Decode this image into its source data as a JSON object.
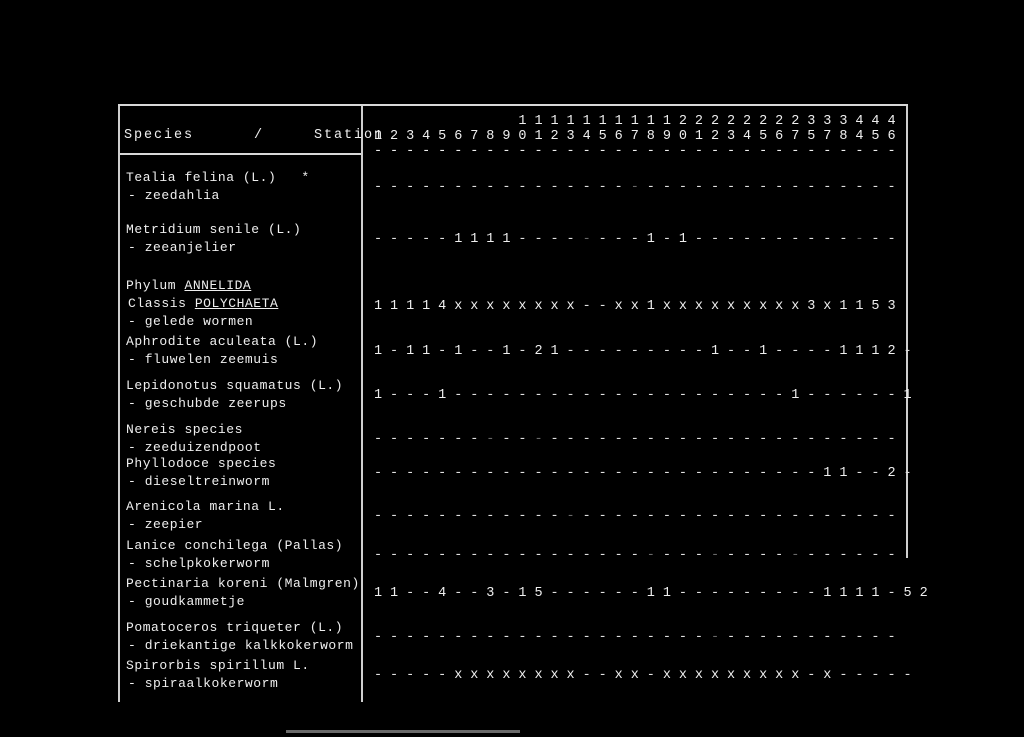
{
  "document": {
    "kind": "scanned-table-page",
    "header": {
      "species_label": "Species      /     Station"
    },
    "stations": {
      "tens": [
        " ",
        " ",
        " ",
        " ",
        " ",
        " ",
        " ",
        " ",
        " ",
        "1",
        "1",
        "1",
        "1",
        "1",
        "1",
        "1",
        "1",
        "1",
        "1",
        "2",
        "2",
        "2",
        "2",
        "2",
        "2",
        "2",
        "2",
        "3",
        "3",
        "3",
        "4",
        "4",
        "4"
      ],
      "units": [
        "1",
        "2",
        "3",
        "4",
        "5",
        "6",
        "7",
        "8",
        "9",
        "0",
        "1",
        "2",
        "3",
        "4",
        "5",
        "6",
        "7",
        "8",
        "9",
        "0",
        "1",
        "2",
        "3",
        "4",
        "5",
        "6",
        "7",
        "5",
        "7",
        "8",
        "4",
        "5",
        "6"
      ],
      "labels": [
        "1",
        "2",
        "3",
        "4",
        "5",
        "6",
        "7",
        "8",
        "9",
        "10",
        "11",
        "12",
        "13",
        "14",
        "15",
        "16",
        "17",
        "18",
        "19",
        "20",
        "21",
        "22",
        "23",
        "24",
        "25",
        "26",
        "27",
        "35",
        "37",
        "38",
        "44",
        "45",
        "46"
      ],
      "rule_row": [
        "-",
        "-",
        "-",
        "-",
        "-",
        "-",
        "-",
        "-",
        "-",
        "-",
        "-",
        "-",
        "-",
        "-",
        "-",
        "-",
        "-",
        "-",
        "-",
        "-",
        "-",
        "-",
        "-",
        "-",
        "-",
        "-",
        "-",
        "-",
        "-",
        "-",
        "-",
        "-",
        "-"
      ]
    },
    "rows": [
      {
        "id": "tealia-felina",
        "name_lines": [
          "Tealia felina (L.)   *",
          "- zeedahlia"
        ],
        "underline_words": [],
        "values": [
          "-",
          "-",
          "-",
          "-",
          "-",
          "-",
          "-",
          "-",
          "-",
          "-",
          "-",
          "-",
          "-",
          "-",
          "-",
          "-",
          ".",
          "-",
          "-",
          "-",
          "-",
          "-",
          "-",
          "-",
          "-",
          "-",
          "-",
          "-",
          "-",
          "-",
          "-",
          "-",
          "-"
        ]
      },
      {
        "id": "metridium-senile",
        "name_lines": [
          "Metridium senile (L.)",
          "- zeeanjelier"
        ],
        "underline_words": [],
        "values": [
          "-",
          "-",
          "-",
          "-",
          "-",
          "1",
          "1",
          "1",
          "1",
          "-",
          "-",
          "-",
          "-",
          ".",
          "-",
          "-",
          "-",
          "1",
          "-",
          "1",
          "-",
          "-",
          "-",
          "-",
          "-",
          "-",
          "-",
          "-",
          "-",
          "-",
          ".",
          "-",
          "-"
        ]
      },
      {
        "id": "phylum-annelida-polychaeta",
        "name_lines": [
          "Phylum ANNELIDA",
          "Classis POLYCHAETA",
          "- gelede wormen"
        ],
        "underline_words": [
          "ANNELIDA",
          "POLYCHAETA"
        ],
        "values": [
          "1",
          "1",
          "1",
          "1",
          "4",
          "x",
          "x",
          "x",
          "x",
          "x",
          "x",
          "x",
          "x",
          "-",
          "-",
          "x",
          "x",
          "1",
          "x",
          "x",
          "x",
          "x",
          "x",
          "x",
          "x",
          "x",
          "x",
          "3",
          "x",
          "1",
          "1",
          "5",
          "3"
        ]
      },
      {
        "id": "aphrodite-aculeata",
        "name_lines": [
          "Aphrodite aculeata (L.)",
          "- fluwelen zeemuis"
        ],
        "underline_words": [],
        "values": [
          "1",
          "-",
          "1",
          "1",
          "-",
          "1",
          "-",
          "-",
          "1",
          "-",
          "2",
          "1",
          "-",
          "-",
          "-",
          "-",
          "-",
          "-",
          "-",
          "-",
          "-",
          "1",
          "-",
          "-",
          "1",
          "-",
          "-",
          "-",
          "-",
          "1",
          "1",
          "1",
          "2",
          "-"
        ]
      },
      {
        "id": "lepidonotus-squamatus",
        "name_lines": [
          "Lepidonotus squamatus (L.)",
          "- geschubde zeerups"
        ],
        "underline_words": [],
        "values": [
          "1",
          "-",
          "-",
          "-",
          "1",
          "-",
          "-",
          "-",
          "-",
          "-",
          "-",
          "-",
          "-",
          "-",
          "-",
          "-",
          "-",
          "-",
          "-",
          "-",
          "-",
          "-",
          "-",
          "-",
          "-",
          "-",
          "1",
          "-",
          "-",
          "-",
          "-",
          "-",
          "-",
          "1"
        ]
      },
      {
        "id": "nereis-species",
        "name_lines": [
          "Nereis species",
          "- zeeduizendpoot"
        ],
        "underline_words": [],
        "values": [
          "-",
          "-",
          "-",
          "-",
          "-",
          "-",
          "-",
          ".",
          "-",
          "-",
          ".",
          "-",
          "-",
          "-",
          "-",
          "-",
          "-",
          "-",
          "-",
          "-",
          "-",
          "-",
          "-",
          "-",
          "-",
          "-",
          "-",
          "-",
          "-",
          "-",
          "-",
          "-",
          "-"
        ]
      },
      {
        "id": "phyllodoce-species",
        "name_lines": [
          "Phyllodoce species",
          "- dieseltreinworm"
        ],
        "underline_words": [],
        "values": [
          "-",
          "-",
          "-",
          "-",
          "-",
          "-",
          "-",
          "-",
          "-",
          "-",
          "-",
          "-",
          "-",
          "-",
          "-",
          "-",
          "-",
          "-",
          "-",
          "-",
          "-",
          "-",
          "-",
          "-",
          "-",
          "-",
          "-",
          "-",
          "1",
          "1",
          "-",
          "-",
          "2",
          "-"
        ]
      },
      {
        "id": "arenicola-marina",
        "name_lines": [
          "Arenicola marina L.",
          "- zeepier"
        ],
        "underline_words": [],
        "values": [
          "-",
          "-",
          "-",
          "-",
          "-",
          "-",
          "-",
          "-",
          "-",
          "-",
          "-",
          "-",
          ".",
          "-",
          "-",
          "-",
          "-",
          "-",
          "-",
          "-",
          "-",
          "-",
          "-",
          "-",
          "-",
          "-",
          "-",
          "-",
          "-",
          "-",
          "-",
          "-",
          "-"
        ]
      },
      {
        "id": "lanice-conchilega",
        "name_lines": [
          "Lanice conchilega (Pallas)",
          "- schelpkokerworm"
        ],
        "underline_words": [],
        "values": [
          "-",
          "-",
          "-",
          "-",
          "-",
          "-",
          "-",
          "-",
          "-",
          "-",
          "-",
          "-",
          "-",
          "-",
          "-",
          "-",
          "-",
          ",",
          "-",
          "-",
          "-",
          ".",
          "-",
          "-",
          "-",
          "-",
          ",",
          "-",
          "-",
          "-",
          "-",
          "-",
          "-"
        ]
      },
      {
        "id": "pectinaria-koreni",
        "name_lines": [
          "Pectinaria koreni (Malmgren)",
          "- goudkammetje"
        ],
        "underline_words": [],
        "values": [
          "1",
          "1",
          "-",
          "-",
          "4",
          "-",
          "-",
          "3",
          "-",
          "1",
          "5",
          "-",
          "-",
          "-",
          "-",
          "-",
          "-",
          "1",
          "1",
          "-",
          "-",
          "-",
          "-",
          "-",
          "-",
          "-",
          "-",
          "-",
          "1",
          "1",
          "1",
          "1",
          "-",
          "5",
          "2"
        ]
      },
      {
        "id": "pomatoceros-triqueter",
        "name_lines": [
          "Pomatoceros triqueter (L.)",
          "- driekantige kalkkokerworm"
        ],
        "underline_words": [],
        "values": [
          "-",
          "-",
          "-",
          "-",
          "-",
          "-",
          "-",
          "-",
          "-",
          "-",
          "-",
          "-",
          "-",
          "-",
          "-",
          "-",
          "-",
          "-",
          "-",
          "-",
          "-",
          ".",
          "-",
          "-",
          "-",
          "-",
          "-",
          "-",
          "-",
          "-",
          "-",
          "-",
          "-"
        ]
      },
      {
        "id": "spirorbis-spirillum",
        "name_lines": [
          "Spirorbis spirillum L.",
          "- spiraalkokerworm"
        ],
        "underline_words": [],
        "values": [
          "-",
          "-",
          "-",
          "-",
          "-",
          "x",
          "x",
          "x",
          "x",
          "x",
          "x",
          "x",
          "x",
          "-",
          "-",
          "x",
          "x",
          "-",
          "x",
          "x",
          "x",
          "x",
          "x",
          "x",
          "x",
          "x",
          "x",
          "-",
          "x",
          "-",
          "-",
          "-",
          "-",
          "-"
        ]
      }
    ]
  },
  "colors": {
    "page_background": "#000000",
    "ink": "#efefef",
    "rule": "#d8d8d8",
    "faint_ink": "#6a6a6a"
  }
}
